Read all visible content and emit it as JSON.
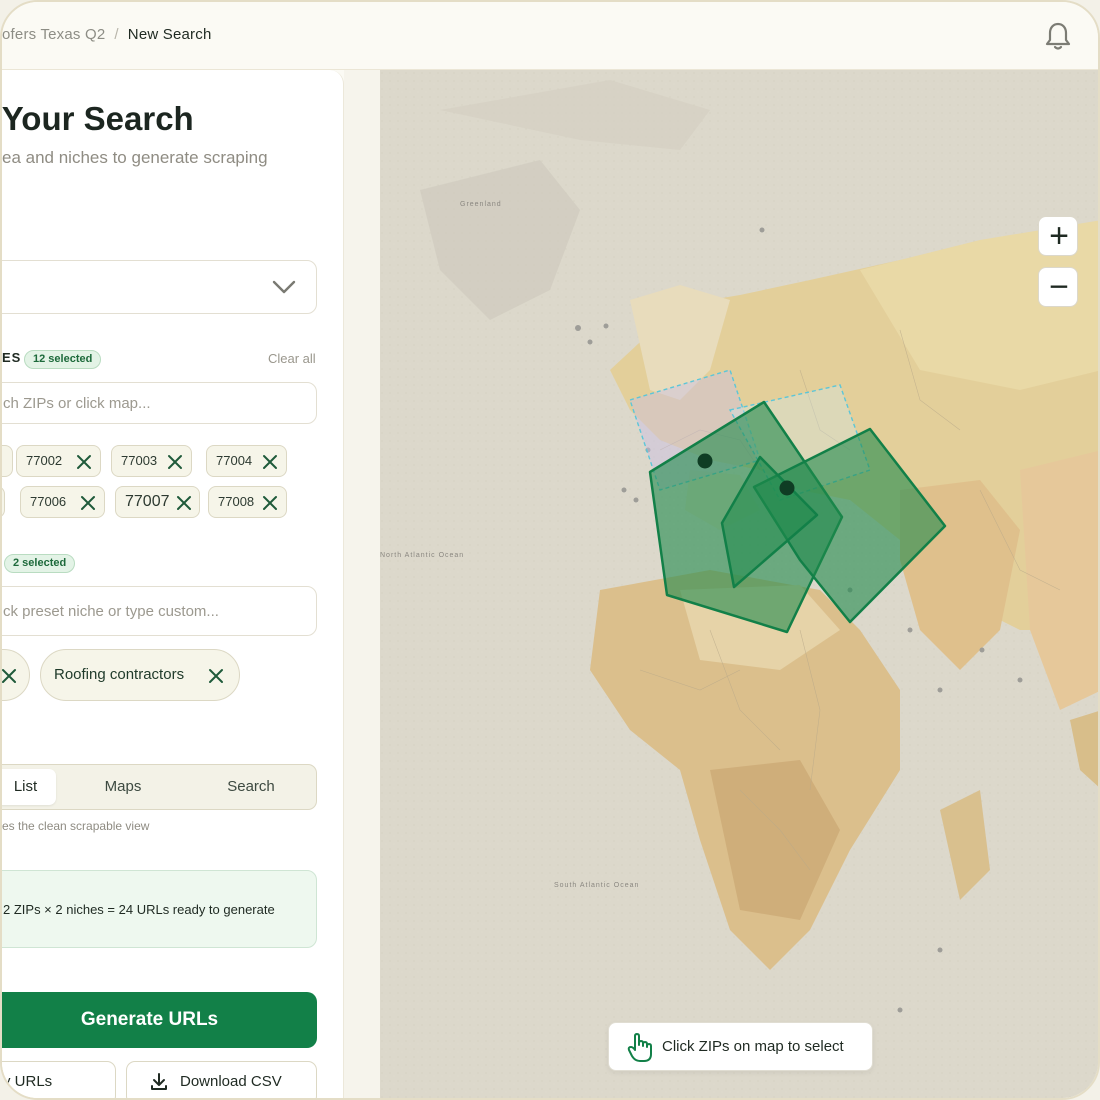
{
  "breadcrumb": {
    "previous": "ofers Texas Q2",
    "separator": "/",
    "current": "New Search"
  },
  "panel": {
    "title": "l Your Search",
    "subtitle": "ea and niches to generate scraping"
  },
  "zips": {
    "label": "ES",
    "selected_badge": "12 selected",
    "clear_label": "Clear all",
    "search_placeholder": "ch ZIPs or click map...",
    "chips": [
      "77002",
      "77003",
      "77004",
      "77006",
      "77007",
      "77008"
    ]
  },
  "niches": {
    "selected_badge": "2 selected",
    "input_placeholder": "ck preset niche or type custom...",
    "chips": [
      "Roofing contractors"
    ]
  },
  "view_toggle": {
    "options": [
      "List",
      "Maps",
      "Search"
    ],
    "active": "List",
    "hint": "es the clean scrapable view"
  },
  "summary": {
    "text": "2 ZIPs × 2 niches = 24 URLs ready to generate"
  },
  "actions": {
    "generate": "Generate URLs",
    "copy": "y URLs",
    "download": "Download CSV"
  },
  "map": {
    "labels": [
      "Greenland",
      "North Atlantic Ocean",
      "South Atlantic Ocean"
    ],
    "hint": "Click ZIPs on map to select",
    "zoom_in": "+",
    "zoom_out": "−"
  },
  "colors": {
    "brand_green": "#128048",
    "polygon_fill": "#1f8a4c",
    "selection_dashed": "#5cc6d8"
  }
}
